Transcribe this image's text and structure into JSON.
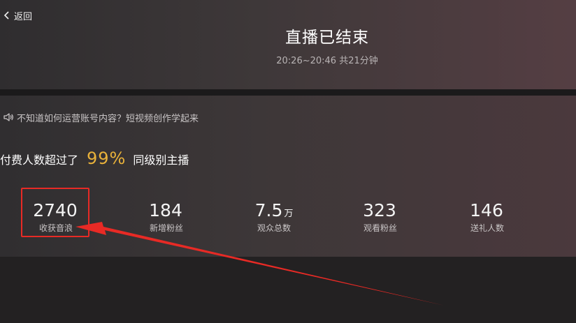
{
  "header": {
    "back_label": "返回",
    "title": "直播已结束",
    "subtitle": "20:26~20:46 共21分钟"
  },
  "notice": {
    "text": "不知道如何运营账号内容？短视频创作学起来",
    "icon": "speaker-icon"
  },
  "rank": {
    "prefix": "付费人数超过了",
    "percent": "99%",
    "suffix": "同级别主播",
    "accent_color": "#e9b23a"
  },
  "stats": [
    {
      "value": "2740",
      "unit": "",
      "label": "收获音浪"
    },
    {
      "value": "184",
      "unit": "",
      "label": "新增粉丝"
    },
    {
      "value": "7.5",
      "unit": "万",
      "label": "观众总数"
    },
    {
      "value": "323",
      "unit": "",
      "label": "观看粉丝"
    },
    {
      "value": "146",
      "unit": "",
      "label": "送礼人数"
    }
  ],
  "annotation": {
    "color": "#e82a25"
  }
}
